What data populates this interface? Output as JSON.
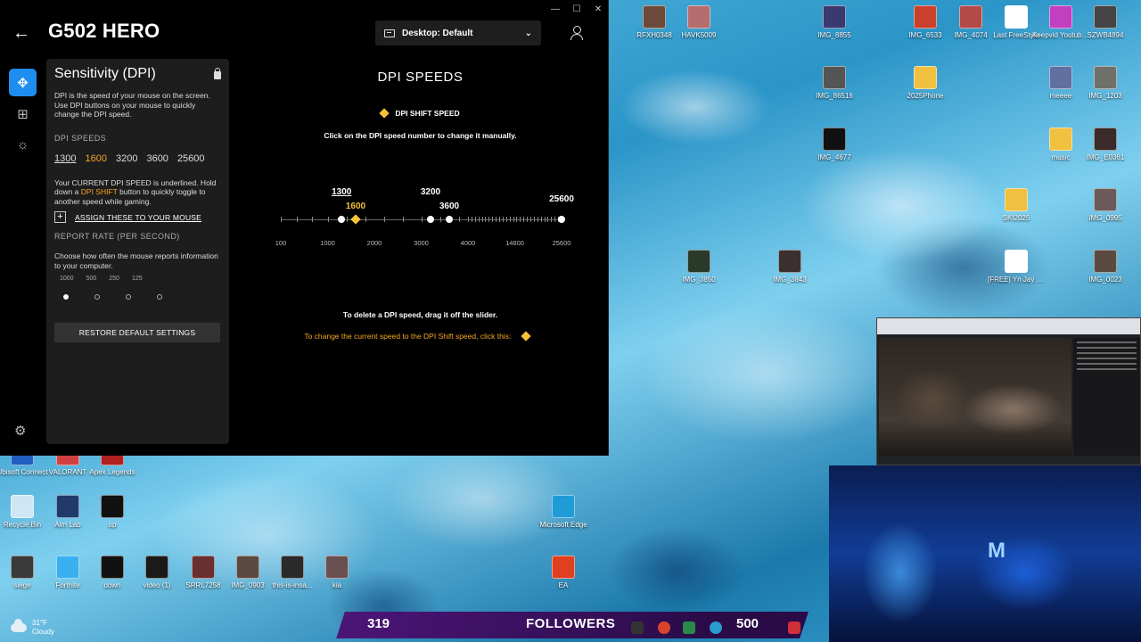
{
  "window": {
    "device_title": "G502 HERO",
    "profile": "Desktop: Default",
    "controls": [
      "—",
      "☐",
      "✕"
    ]
  },
  "side_panel": {
    "title": "Sensitivity (DPI)",
    "description": "DPI is the speed of your mouse on the screen. Use DPI buttons on your mouse to quickly change the DPI speed.",
    "dpi_speeds_heading": "DPI SPEEDS",
    "dpi_speeds": [
      "1300",
      "1600",
      "3200",
      "3600",
      "25600"
    ],
    "current_note_1": "Your CURRENT DPI SPEED is underlined. Hold down a ",
    "current_note_shift": "DPI SHIFT",
    "current_note_2": " button to quickly toggle to another speed while gaming.",
    "assign_label": "ASSIGN THESE TO YOUR MOUSE",
    "report_heading": "REPORT RATE (PER SECOND)",
    "report_desc": "Choose how often the mouse reports information to your computer.",
    "report_rates": [
      "1000",
      "500",
      "250",
      "125"
    ],
    "restore_label": "RESTORE DEFAULT SETTINGS"
  },
  "main": {
    "title": "DPI SPEEDS",
    "legend": "DPI SHIFT SPEED",
    "instruction": "Click on the DPI speed number to change it manually.",
    "axis_labels": [
      "100",
      "1000",
      "2000",
      "3000",
      "4000",
      "14800",
      "25600"
    ],
    "nodes": [
      {
        "label": "1300",
        "kind": "current"
      },
      {
        "label": "1600",
        "kind": "shift"
      },
      {
        "label": "3200",
        "kind": "normal"
      },
      {
        "label": "3600",
        "kind": "normal"
      },
      {
        "label": "25600",
        "kind": "normal"
      }
    ],
    "delete_note": "To delete a DPI speed, drag it off the slider.",
    "shift_note": "To change the current speed to the DPI Shift speed, click this:"
  },
  "desktop": {
    "icons": [
      {
        "label": "RFXH0348",
        "color": "#6b4a3a"
      },
      {
        "label": "HAVK5009",
        "color": "#b46c6c"
      },
      {
        "label": "IMG_8855",
        "color": "#3a3a70"
      },
      {
        "label": "IMG_6533",
        "color": "#c9402d"
      },
      {
        "label": "IMG_4074",
        "color": "#b34a4a"
      },
      {
        "label": "Last FreeStyle",
        "color": "#ffffff"
      },
      {
        "label": "Keepvid Youtube D...",
        "color": "#c040c0"
      },
      {
        "label": "SZWB4894",
        "color": "#444444"
      },
      {
        "label": "IMG_86516",
        "color": "#555555"
      },
      {
        "label": "2025Phone",
        "color": "#f0c040"
      },
      {
        "label": "meeee",
        "color": "#6070a0"
      },
      {
        "label": "IMG_1203",
        "color": "#70706a"
      },
      {
        "label": "IMG_4677",
        "color": "#111111"
      },
      {
        "label": "music",
        "color": "#f0c040"
      },
      {
        "label": "IMG_E0361",
        "color": "#3a2a2a"
      },
      {
        "label": "SKI2025",
        "color": "#f0c040"
      },
      {
        "label": "IMG_0995",
        "color": "#6a5a5a"
      },
      {
        "label": "IMG_3850",
        "color": "#2a3a2a"
      },
      {
        "label": "IMG_3843",
        "color": "#3a3030"
      },
      {
        "label": "[FREE] Yn Jay x Detroit Sa...",
        "color": "#ffffff"
      },
      {
        "label": "IMG_0023",
        "color": "#5a4a40"
      },
      {
        "label": "Ubisoft Connect",
        "color": "#2060c0"
      },
      {
        "label": "VALORANT",
        "color": "#d04040"
      },
      {
        "label": "Apex Legends",
        "color": "#b02020"
      },
      {
        "label": "Recycle Bin",
        "color": "#cfe6f5"
      },
      {
        "label": "Aim Lab",
        "color": "#203a6a"
      },
      {
        "label": "up",
        "color": "#111111"
      },
      {
        "label": "Microsoft Edge",
        "color": "#1f9bd6"
      },
      {
        "label": "siege",
        "color": "#3a3a3a"
      },
      {
        "label": "Fortnite",
        "color": "#3ab0f0"
      },
      {
        "label": "down",
        "color": "#111111"
      },
      {
        "label": "video (1)",
        "color": "#1a1a1a"
      },
      {
        "label": "SRRL7258",
        "color": "#6a3030"
      },
      {
        "label": "IMG_0903",
        "color": "#5a4a40"
      },
      {
        "label": "this-is-insa...",
        "color": "#2a2a2a"
      },
      {
        "label": "kia",
        "color": "#6a5050"
      },
      {
        "label": "EA",
        "color": "#e04020"
      }
    ]
  },
  "overlay": {
    "followers_count": "319",
    "followers_label": "FOLLOWERS",
    "goal": "500",
    "webcam_letter": "M"
  },
  "weather": {
    "temp": "31°F",
    "condition": "Cloudy"
  }
}
